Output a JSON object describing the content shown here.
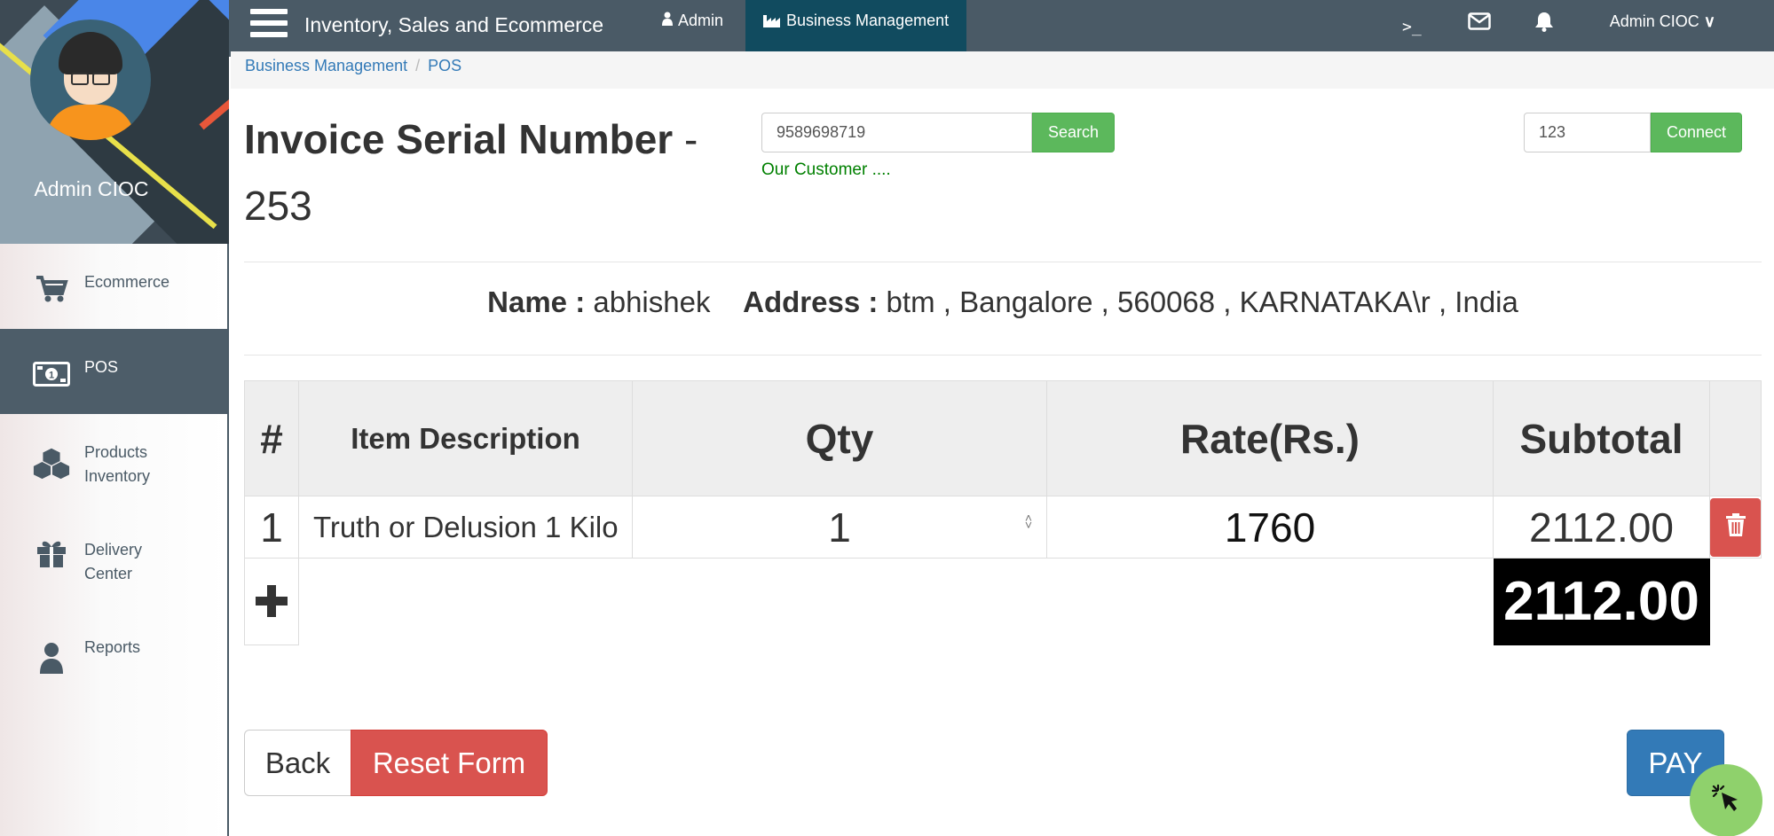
{
  "sidebar": {
    "profile_name": "Admin CIOC",
    "items": [
      {
        "label": "Ecommerce",
        "icon": "cart-icon",
        "active": false
      },
      {
        "label": "POS",
        "icon": "money-icon",
        "active": true
      },
      {
        "label": "Products\nInventory",
        "icon": "cubes-icon",
        "active": false
      },
      {
        "label": "Delivery\nCenter",
        "icon": "gift-icon",
        "active": false
      },
      {
        "label": "Reports",
        "icon": "user-icon",
        "active": false
      }
    ]
  },
  "topbar": {
    "app_title": "Inventory, Sales and Ecommerce",
    "links": [
      {
        "label": "Admin",
        "icon": "user-icon"
      },
      {
        "label": "Business Management",
        "icon": "industry-icon",
        "active": true
      }
    ],
    "icons": [
      "terminal-icon",
      "envelope-icon",
      "bell-icon"
    ],
    "user_label": "Admin CIOC"
  },
  "breadcrumb": [
    "Business Management",
    "POS"
  ],
  "invoice": {
    "title": "Invoice Serial Number",
    "separator": "-",
    "number": "253"
  },
  "search": {
    "value": "9589698719",
    "button": "Search",
    "note": "Our Customer ...."
  },
  "connect": {
    "value": "123",
    "button": "Connect"
  },
  "customer": {
    "name_label": "Name :",
    "name": "abhishek",
    "address_label": "Address :",
    "address": "btm , Bangalore , 560068 , KARNATAKA\\r , India"
  },
  "table": {
    "headers": [
      "#",
      "Item Description",
      "Qty",
      "Rate(Rs.)",
      "Subtotal"
    ],
    "rows": [
      {
        "num": "1",
        "description": "Truth or Delusion 1 Kilo",
        "qty": "1",
        "rate": "1760",
        "subtotal": "2112.00"
      }
    ],
    "total": "2112.00"
  },
  "buttons": {
    "back": "Back",
    "reset": "Reset Form",
    "pay": "PAY"
  },
  "colors": {
    "topbar": "#4a5a66",
    "active_tab": "#114b5f",
    "success": "#5cb85c",
    "danger": "#d9534f",
    "primary": "#337ab7"
  }
}
